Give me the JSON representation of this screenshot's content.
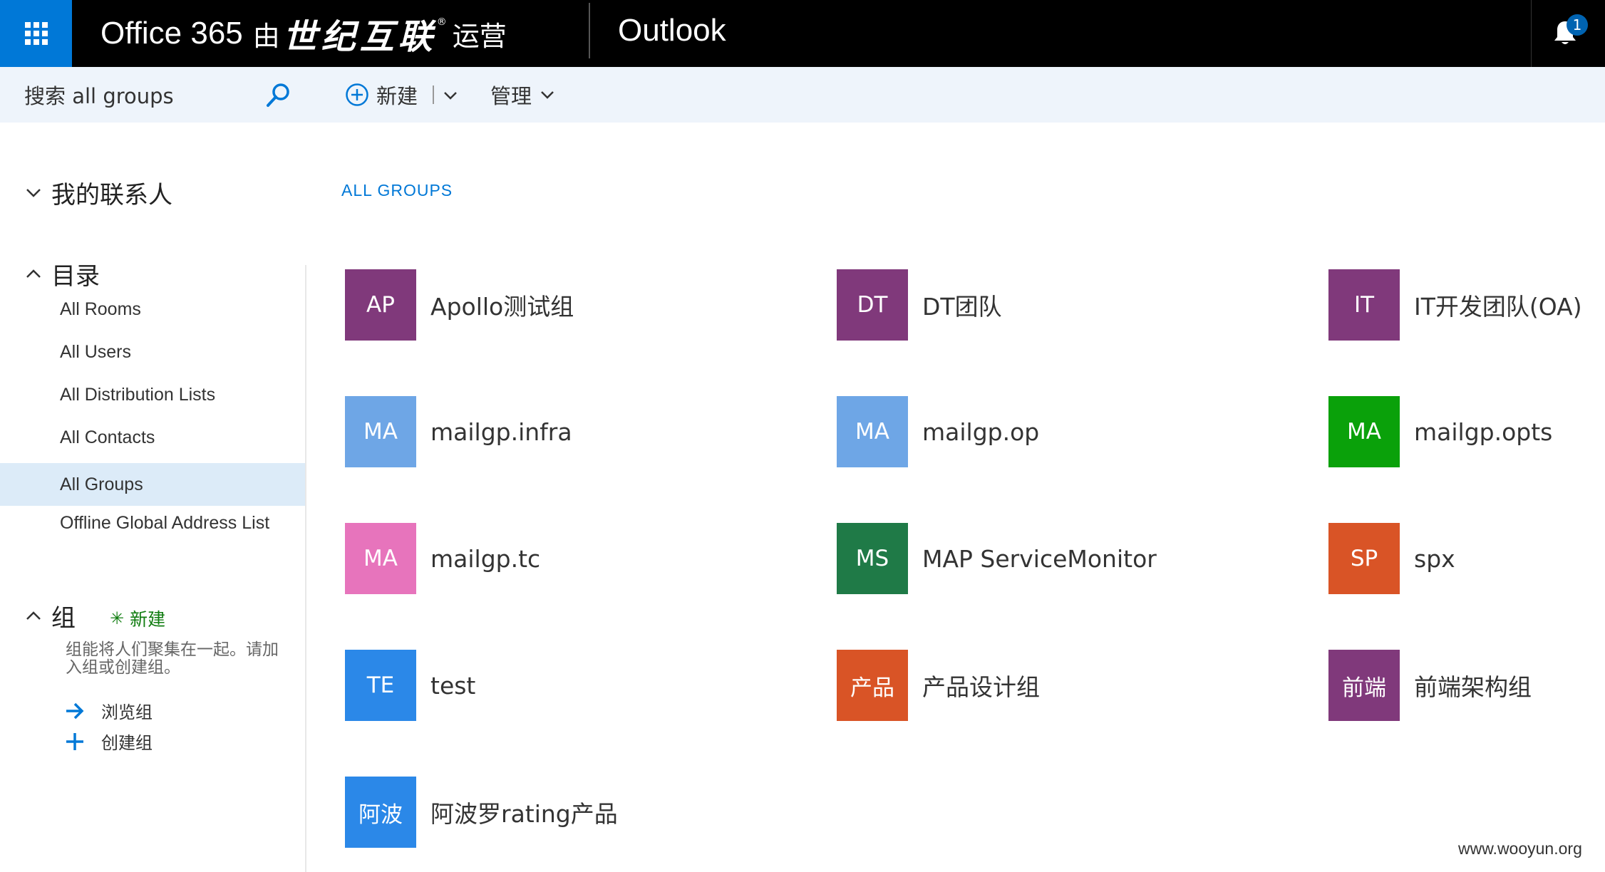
{
  "topbar": {
    "brand_office": "Office 365",
    "brand_you": "由",
    "brand_shiji": "世纪互联",
    "brand_reg": "®",
    "brand_yunying": "运营",
    "app_name": "Outlook",
    "notification_count": "1"
  },
  "commandbar": {
    "search_text": "搜索 all groups",
    "new_label": "新建",
    "manage_label": "管理"
  },
  "leftnav": {
    "my_contacts": "我的联系人",
    "directory": "目录",
    "directory_items": [
      {
        "label": "All Rooms"
      },
      {
        "label": "All Users"
      },
      {
        "label": "All Distribution Lists"
      },
      {
        "label": "All Contacts"
      },
      {
        "label": "All Groups",
        "selected": true
      },
      {
        "label": "Offline Global Address List"
      }
    ],
    "groups_title": "组",
    "groups_new": "新建",
    "groups_desc": "组能将人们聚集在一起。请加入组或创建组。",
    "browse_groups": "浏览组",
    "create_group": "创建组"
  },
  "main": {
    "breadcrumb": "ALL GROUPS",
    "groups": [
      {
        "initials": "AP",
        "name": "Apollo测试组",
        "color": "#80397b"
      },
      {
        "initials": "DT",
        "name": "DT团队",
        "color": "#80397b"
      },
      {
        "initials": "IT",
        "name": "IT开发团队(OA)",
        "color": "#80397b"
      },
      {
        "initials": "MA",
        "name": "mailgp.infra",
        "color": "#6ea6e6"
      },
      {
        "initials": "MA",
        "name": "mailgp.op",
        "color": "#6ea6e6"
      },
      {
        "initials": "MA",
        "name": "mailgp.opts",
        "color": "#0aa10a"
      },
      {
        "initials": "MA",
        "name": "mailgp.tc",
        "color": "#e774bc"
      },
      {
        "initials": "MS",
        "name": "MAP ServiceMonitor",
        "color": "#1f7a47"
      },
      {
        "initials": "SP",
        "name": "spx",
        "color": "#d95426"
      },
      {
        "initials": "TE",
        "name": "test",
        "color": "#2b88e8"
      },
      {
        "initials": "产品",
        "name": "产品设计组",
        "color": "#d95426"
      },
      {
        "initials": "前端",
        "name": "前端架构组",
        "color": "#80397b"
      },
      {
        "initials": "阿波",
        "name": "阿波罗rating产品",
        "color": "#2b88e8"
      }
    ]
  },
  "watermark": "www.wooyun.org"
}
